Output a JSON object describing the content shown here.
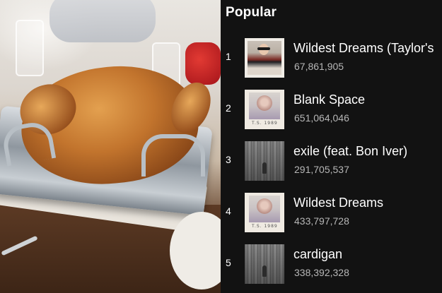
{
  "section": {
    "title": "Popular"
  },
  "tracks": [
    {
      "rank": "1",
      "title": "Wildest Dreams (Taylor's",
      "plays": "67,861,905",
      "art": "wildest-dreams-tv"
    },
    {
      "rank": "2",
      "title": "Blank Space",
      "plays": "651,064,046",
      "art": "1989",
      "caption": "T.S.   1989"
    },
    {
      "rank": "3",
      "title": "exile (feat. Bon Iver)",
      "plays": "291,705,537",
      "art": "folklore"
    },
    {
      "rank": "4",
      "title": "Wildest Dreams",
      "plays": "433,797,728",
      "art": "1989",
      "caption": "T.S.   1989"
    },
    {
      "rank": "5",
      "title": "cardigan",
      "plays": "338,392,328",
      "art": "folklore"
    }
  ],
  "colors": {
    "background": "#121212",
    "text": "#ffffff",
    "secondary_text": "#b7b7b7"
  }
}
